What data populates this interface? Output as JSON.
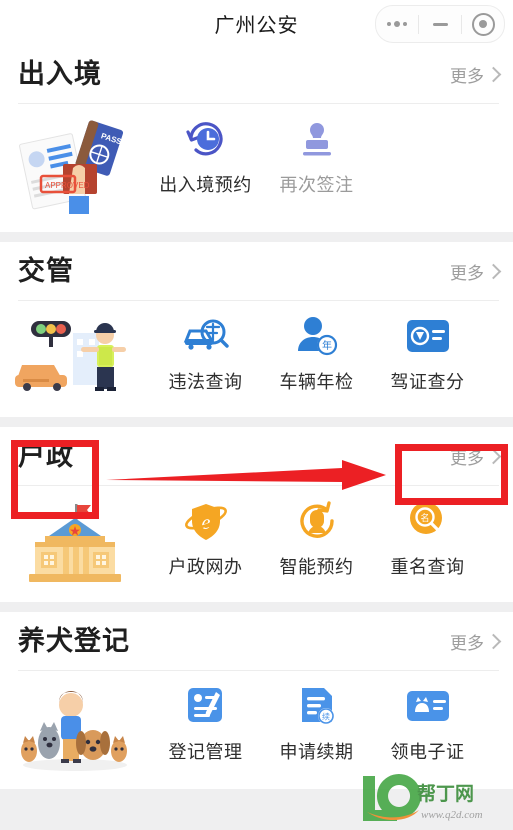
{
  "navbar": {
    "title": "广州公安",
    "capsule": {
      "menu_icon": "ellipsis-icon",
      "minimize_icon": "minus-icon",
      "close_icon": "target-circle-icon"
    }
  },
  "more_label": "更多",
  "sections": [
    {
      "id": "exit-entry",
      "title": "出入境",
      "more": "更多",
      "illustration": "passport-documents-illustration",
      "items": [
        {
          "label": "出入境预约",
          "icon": "clock-refresh-icon",
          "color": "#4b55c6",
          "state": "active"
        },
        {
          "label": "再次签注",
          "icon": "stamp-icon",
          "color": "#9098de",
          "state": "disabled"
        }
      ]
    },
    {
      "id": "traffic",
      "title": "交管",
      "more": "更多",
      "illustration": "traffic-police-car-illustration",
      "items": [
        {
          "label": "违法查询",
          "icon": "car-search-icon",
          "color": "#2e7fd4",
          "state": "active"
        },
        {
          "label": "车辆年检",
          "icon": "person-year-icon",
          "color": "#2e7fd4",
          "state": "active"
        },
        {
          "label": "驾证查分",
          "icon": "license-card-icon",
          "color": "#2e7fd4",
          "state": "active"
        }
      ]
    },
    {
      "id": "household",
      "title": "户政",
      "more": "更多",
      "illustration": "government-building-illustration",
      "highlighted": true,
      "items": [
        {
          "label": "户政网办",
          "icon": "e-globe-shield-icon",
          "color": "#f5a623",
          "state": "active"
        },
        {
          "label": "智能预约",
          "icon": "refresh-head-icon",
          "color": "#f5a623",
          "state": "active"
        },
        {
          "label": "重名查询",
          "icon": "name-search-icon",
          "color": "#f5a623",
          "state": "active"
        }
      ]
    },
    {
      "id": "dog-registration",
      "title": "养犬登记",
      "more": "更多",
      "illustration": "person-with-dogs-illustration",
      "items": [
        {
          "label": "登记管理",
          "icon": "document-pen-icon",
          "color": "#4a93e8",
          "state": "active"
        },
        {
          "label": "申请续期",
          "icon": "document-renew-icon",
          "color": "#4a93e8",
          "state": "active"
        },
        {
          "label": "领电子证",
          "icon": "dog-card-icon",
          "color": "#4a93e8",
          "state": "active"
        }
      ]
    }
  ],
  "annotations": {
    "color": "#ec2024",
    "title_box_target": "户政",
    "more_box_target": "更多",
    "arrow": "red-arrow-pointing-right"
  },
  "watermark": {
    "logo_text": "Q2D",
    "brand": "帮丁网",
    "url": "www.q2d.com"
  }
}
